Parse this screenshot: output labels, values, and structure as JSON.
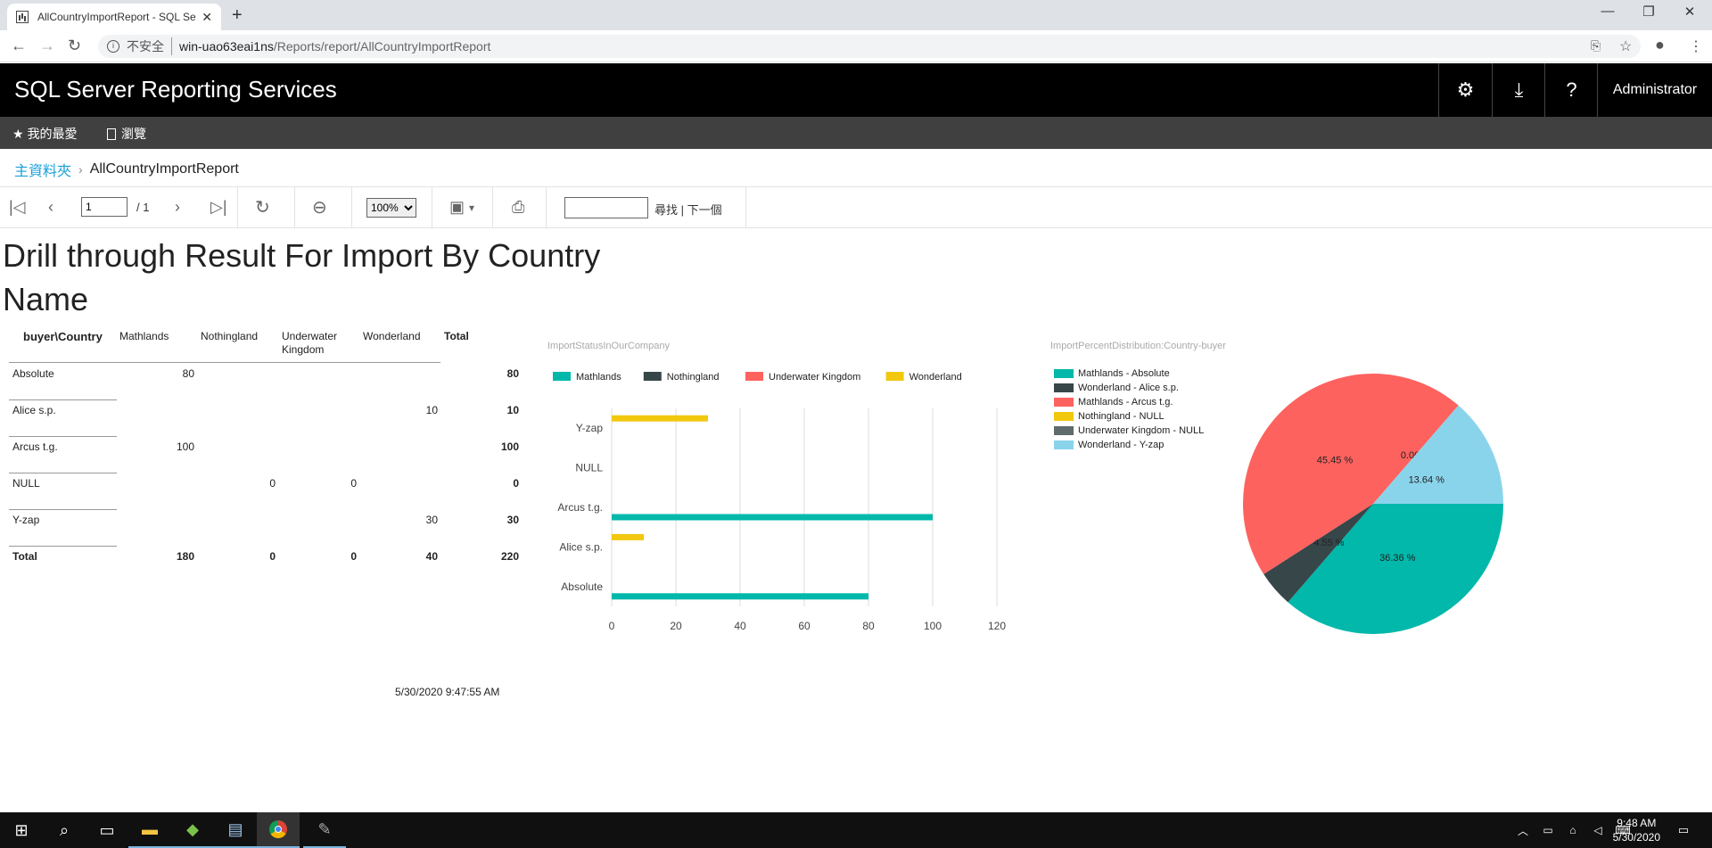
{
  "browser": {
    "tab_title": "AllCountryImportReport - SQL Se",
    "insecure_label": "不安全",
    "url_host": "win-uao63eai1ns",
    "url_path": "/Reports/report/AllCountryImportReport"
  },
  "header": {
    "title": "SQL Server Reporting Services",
    "user": "Administrator"
  },
  "subnav": {
    "favorites": "我的最愛",
    "browse": "瀏覽"
  },
  "breadcrumb": {
    "home": "主資料夾",
    "current": "AllCountryImportReport"
  },
  "toolbar": {
    "page_value": "1",
    "page_total": "/  1",
    "zoom": "100%",
    "find_label": "尋找 | 下一個"
  },
  "report": {
    "title": "Drill through Result For Import By Country Name",
    "timestamp": "5/30/2020 9:47:55 AM",
    "tablix": {
      "corner": "buyer\\Country",
      "columns": [
        "Mathlands",
        "Nothingland",
        "Underwater Kingdom",
        "Wonderland",
        "Total"
      ],
      "rows": [
        {
          "label": "Absolute",
          "values": [
            "80",
            "",
            "",
            "",
            "80"
          ]
        },
        {
          "label": "Alice s.p.",
          "values": [
            "",
            "",
            "",
            "10",
            "10"
          ]
        },
        {
          "label": "Arcus t.g.",
          "values": [
            "100",
            "",
            "",
            "",
            "100"
          ]
        },
        {
          "label": "NULL",
          "values": [
            "",
            "0",
            "0",
            "",
            "0"
          ]
        },
        {
          "label": "Y-zap",
          "values": [
            "",
            "",
            "",
            "30",
            "30"
          ]
        }
      ],
      "total_row": {
        "label": "Total",
        "values": [
          "180",
          "0",
          "0",
          "40",
          "220"
        ]
      }
    }
  },
  "chart_data": [
    {
      "type": "bar",
      "orientation": "horizontal",
      "title": "ImportStatusInOurCompany",
      "categories": [
        "Absolute",
        "Alice s.p.",
        "Arcus t.g.",
        "NULL",
        "Y-zap"
      ],
      "series": [
        {
          "name": "Mathlands",
          "color": "#01b8aa",
          "values": [
            80,
            0,
            100,
            0,
            0
          ]
        },
        {
          "name": "Nothingland",
          "color": "#374649",
          "values": [
            0,
            0,
            0,
            0,
            0
          ]
        },
        {
          "name": "Underwater Kingdom",
          "color": "#fd625e",
          "values": [
            0,
            0,
            0,
            0,
            0
          ]
        },
        {
          "name": "Wonderland",
          "color": "#f2c80f",
          "values": [
            0,
            10,
            0,
            0,
            30
          ]
        }
      ],
      "xlim": [
        0,
        120
      ],
      "xticks": [
        "0",
        "20",
        "40",
        "60",
        "80",
        "100",
        "120"
      ],
      "grid": true,
      "legend": "top"
    },
    {
      "type": "pie",
      "title": "ImportPercentDistribution:Country-buyer",
      "legend": "left",
      "slices": [
        {
          "name": "Mathlands - Absolute",
          "value": 80,
          "color": "#01b8aa",
          "label": "36.36 %"
        },
        {
          "name": "Wonderland - Alice s.p.",
          "value": 10,
          "color": "#374649",
          "label": "4.55 %"
        },
        {
          "name": "Mathlands - Arcus t.g.",
          "value": 100,
          "color": "#fd625e",
          "label": "45.45 %"
        },
        {
          "name": "Nothingland - NULL",
          "value": 0,
          "color": "#f2c80f",
          "label": "0.00 %"
        },
        {
          "name": "Underwater Kingdom - NULL",
          "value": 0,
          "color": "#5f6b6d",
          "label": ""
        },
        {
          "name": "Wonderland - Y-zap",
          "value": 30,
          "color": "#8ad4eb",
          "label": "13.64 %"
        }
      ]
    }
  ],
  "taskbar": {
    "time": "9:48 AM",
    "date": "5/30/2020"
  }
}
